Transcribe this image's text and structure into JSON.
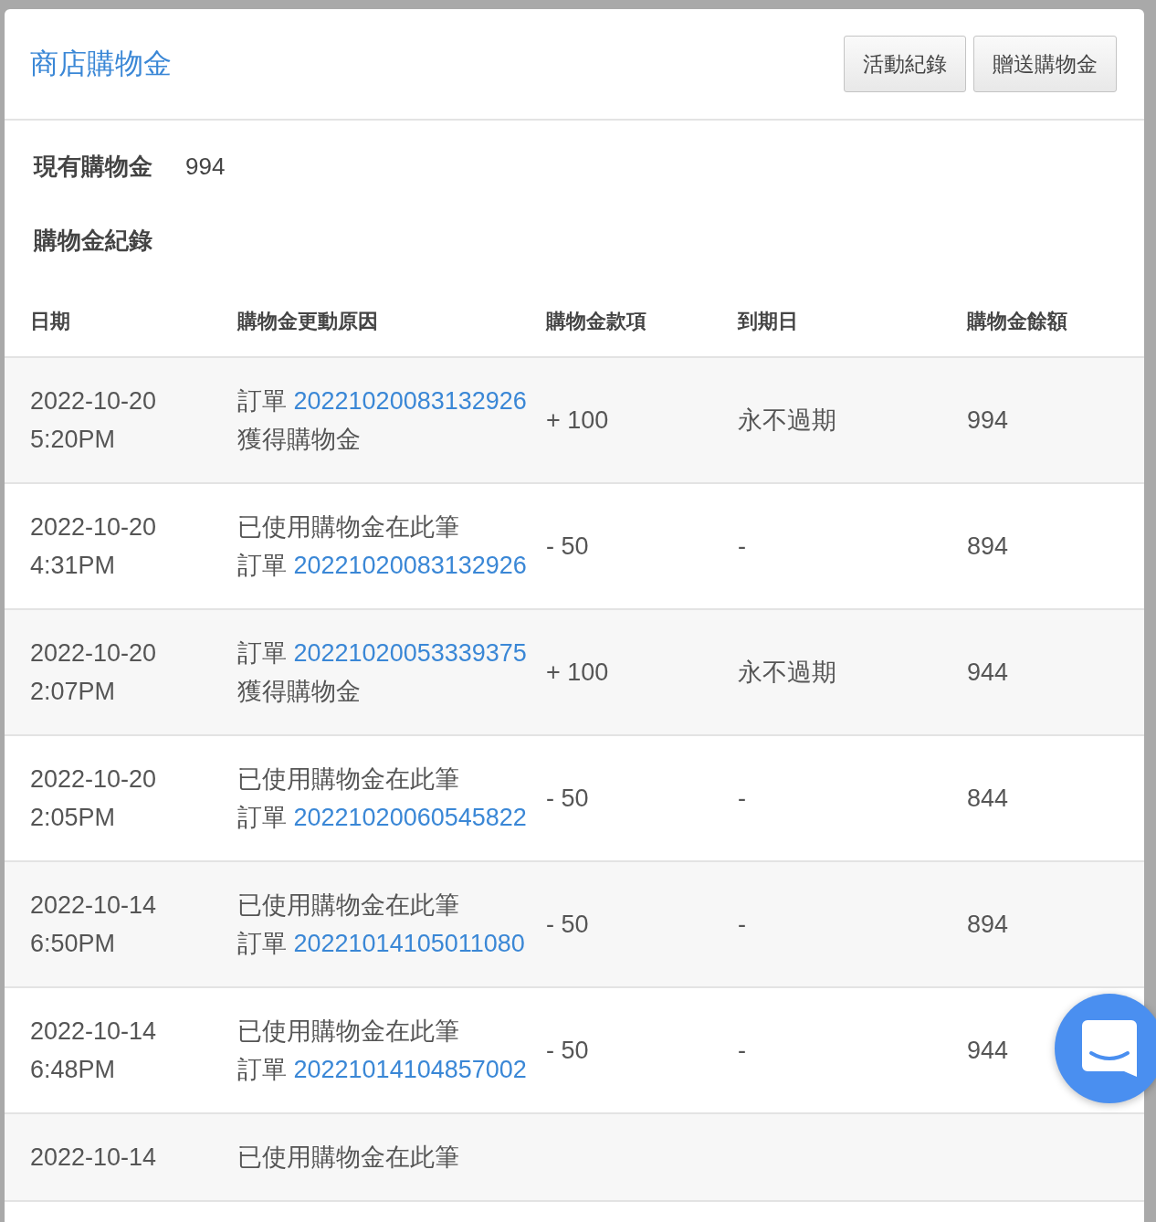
{
  "header": {
    "title": "商店購物金",
    "buttons": [
      "活動紀錄",
      "贈送購物金"
    ]
  },
  "summary": {
    "label": "現有購物金",
    "value": "994"
  },
  "section_title": "購物金紀錄",
  "table": {
    "columns": [
      "日期",
      "購物金更動原因",
      "購物金款項",
      "到期日",
      "購物金餘額"
    ],
    "rows": [
      {
        "date": "2022-10-20",
        "time": "5:20PM",
        "reason": {
          "order_label": "訂單",
          "order_no": "20221020083132926",
          "post": "獲得購物金"
        },
        "amount": "+ 100",
        "expiry": "永不過期",
        "balance": "994"
      },
      {
        "date": "2022-10-20",
        "time": "4:31PM",
        "reason": {
          "pre": "已使用購物金在此筆",
          "order_label": "訂單",
          "order_no": "20221020083132926"
        },
        "amount": "- 50",
        "expiry": "-",
        "balance": "894"
      },
      {
        "date": "2022-10-20",
        "time": "2:07PM",
        "reason": {
          "order_label": "訂單",
          "order_no": "20221020053339375",
          "post": "獲得購物金"
        },
        "amount": "+ 100",
        "expiry": "永不過期",
        "balance": "944"
      },
      {
        "date": "2022-10-20",
        "time": "2:05PM",
        "reason": {
          "pre": "已使用購物金在此筆",
          "order_label": "訂單",
          "order_no": "20221020060545822"
        },
        "amount": "- 50",
        "expiry": "-",
        "balance": "844"
      },
      {
        "date": "2022-10-14",
        "time": "6:50PM",
        "reason": {
          "pre": "已使用購物金在此筆",
          "order_label": "訂單",
          "order_no": "20221014105011080"
        },
        "amount": "- 50",
        "expiry": "-",
        "balance": "894"
      },
      {
        "date": "2022-10-14",
        "time": "6:48PM",
        "reason": {
          "pre": "已使用購物金在此筆",
          "order_label": "訂單",
          "order_no": "20221014104857002"
        },
        "amount": "- 50",
        "expiry": "-",
        "balance": "944"
      },
      {
        "date": "2022-10-14",
        "reason": {
          "pre": "已使用購物金在此筆"
        }
      }
    ]
  }
}
